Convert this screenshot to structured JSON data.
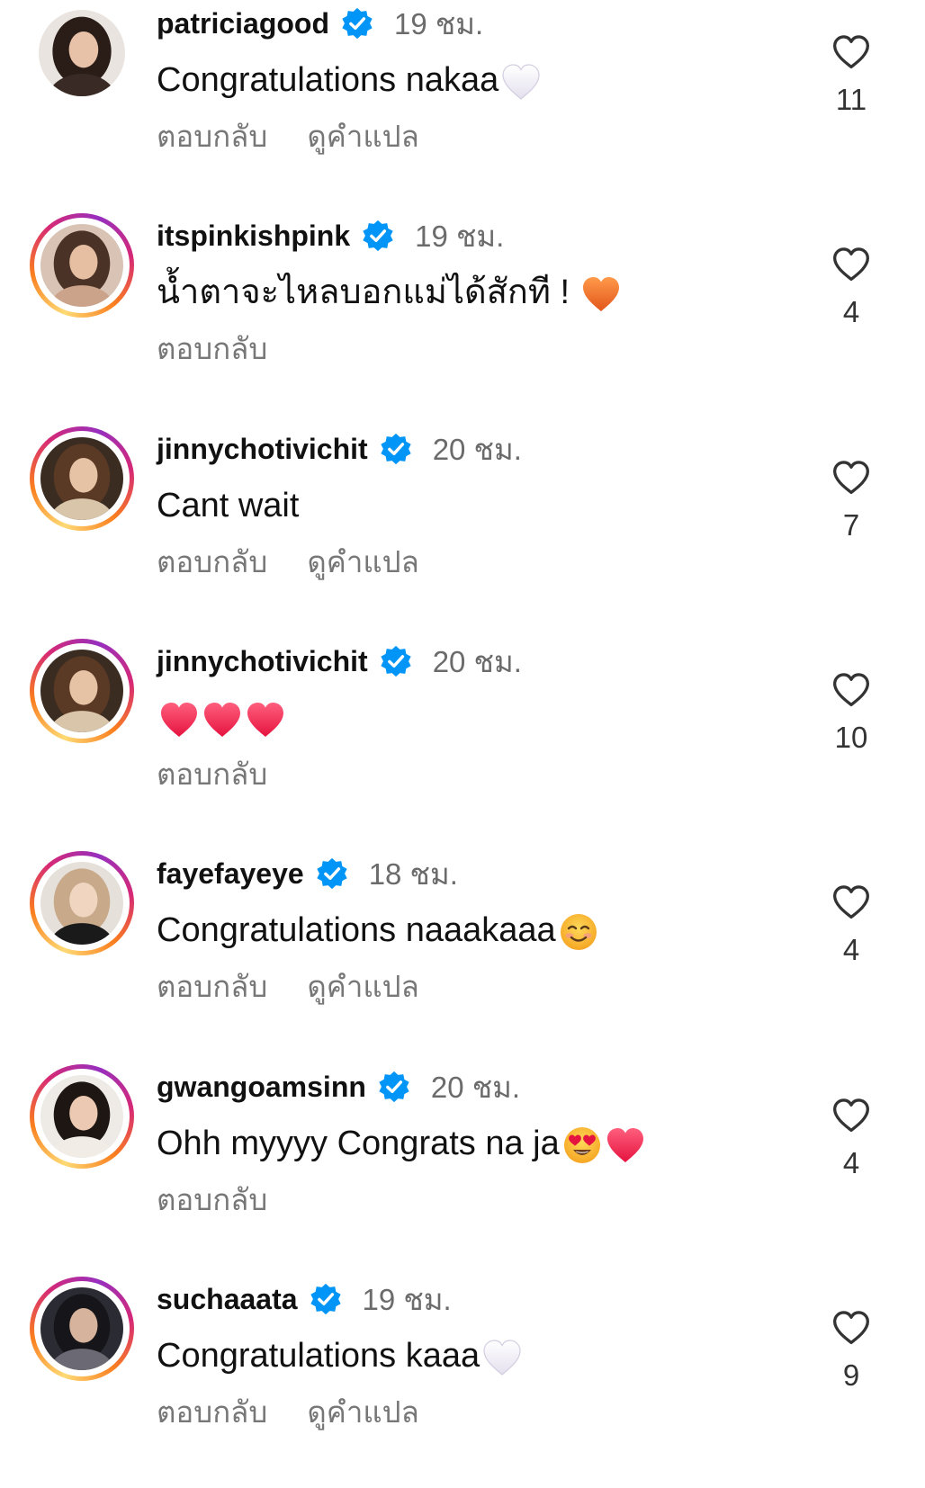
{
  "comments": [
    {
      "username": "patriciagood",
      "time": "19 ชม.",
      "text": "Congratulations nakaa",
      "emojis": [
        "white-heart"
      ],
      "reply": "ตอบกลับ",
      "translate": "ดูคำแปล",
      "likes": "11",
      "story_ring": false
    },
    {
      "username": "itspinkishpink",
      "time": "19 ชม.",
      "text": "น้ำตาจะไหลบอกแม่ได้สักที !",
      "emojis": [
        "orange-heart"
      ],
      "reply": "ตอบกลับ",
      "translate": "",
      "likes": "4",
      "story_ring": true
    },
    {
      "username": "jinnychotivichit",
      "time": "20 ชม.",
      "text": "Cant wait",
      "emojis": [],
      "reply": "ตอบกลับ",
      "translate": "ดูคำแปล",
      "likes": "7",
      "story_ring": true
    },
    {
      "username": "jinnychotivichit",
      "time": "20 ชม.",
      "text": "",
      "emojis": [
        "red-heart",
        "red-heart",
        "red-heart"
      ],
      "reply": "ตอบกลับ",
      "translate": "",
      "likes": "10",
      "story_ring": true
    },
    {
      "username": "fayefayeye",
      "time": "18 ชม.",
      "text": "Congratulations naaakaaa",
      "emojis": [
        "smiling-face"
      ],
      "reply": "ตอบกลับ",
      "translate": "ดูคำแปล",
      "likes": "4",
      "story_ring": true
    },
    {
      "username": "gwangoamsinn",
      "time": "20 ชม.",
      "text": "Ohh myyyy Congrats na ja",
      "emojis": [
        "heart-eyes-face",
        "red-heart"
      ],
      "reply": "ตอบกลับ",
      "translate": "",
      "likes": "4",
      "story_ring": true
    },
    {
      "username": "suchaaata",
      "time": "19 ชม.",
      "text": "Congratulations kaaa",
      "emojis": [
        "white-heart"
      ],
      "reply": "ตอบกลับ",
      "translate": "ดูคำแปล",
      "likes": "9",
      "story_ring": true
    }
  ],
  "colors": {
    "verified_badge": "#0095f6",
    "meta_text": "#777777",
    "story_ring": [
      "#feda75",
      "#fa7e1e",
      "#d62976",
      "#962fbf"
    ]
  }
}
